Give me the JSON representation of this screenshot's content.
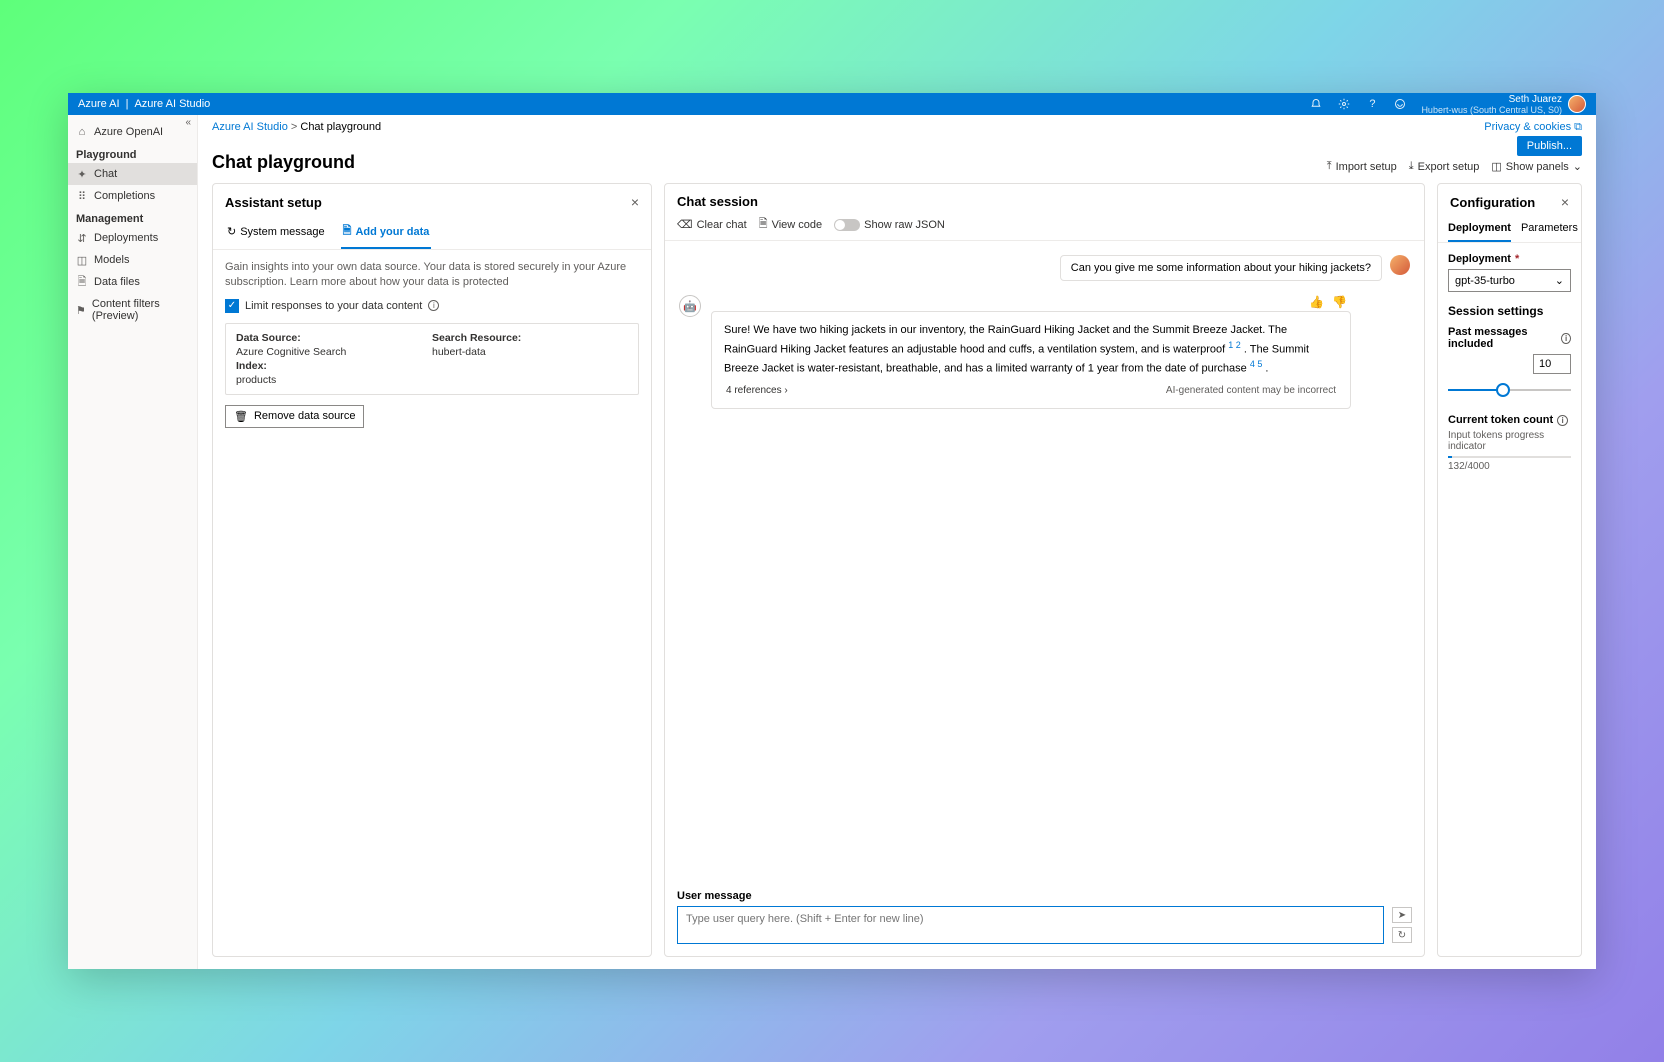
{
  "topbar": {
    "brand_left": "Azure AI",
    "brand_right": "Azure AI Studio",
    "user_name": "Seth Juarez",
    "user_sub": "Hubert-wus (South Central US, S0)"
  },
  "sidebar": {
    "azure_openai": "Azure OpenAI",
    "section_playground": "Playground",
    "chat": "Chat",
    "completions": "Completions",
    "section_management": "Management",
    "deployments": "Deployments",
    "models": "Models",
    "data_files": "Data files",
    "content_filters": "Content filters (Preview)"
  },
  "breadcrumb": {
    "root": "Azure AI Studio",
    "current": "Chat playground",
    "privacy": "Privacy & cookies"
  },
  "page": {
    "title": "Chat playground",
    "publish": "Publish...",
    "import_setup": "Import setup",
    "export_setup": "Export setup",
    "show_panels": "Show panels"
  },
  "assistant": {
    "title": "Assistant setup",
    "tab_system": "System message",
    "tab_data": "Add your data",
    "hint": "Gain insights into your own data source. Your data is stored securely in your Azure subscription. Learn more about how your data is protected",
    "limit_label": "Limit responses to your data content",
    "ds_label": "Data Source:",
    "ds_value": "Azure Cognitive Search",
    "sr_label": "Search Resource:",
    "sr_value": "hubert-data",
    "idx_label": "Index:",
    "idx_value": "products",
    "remove": "Remove data source"
  },
  "chat": {
    "title": "Chat session",
    "clear": "Clear chat",
    "view_code": "View code",
    "raw_json": "Show raw JSON",
    "user_msg": "Can you give me some information about your hiking jackets?",
    "bot_msg_1": "Sure! We have two hiking jackets in our inventory, the RainGuard Hiking Jacket and the Summit Breeze Jacket. The RainGuard Hiking Jacket features an adjustable hood and cuffs, a ventilation system, and is waterproof ",
    "bot_msg_2": " . The Summit Breeze Jacket is water-resistant, breathable, and has a limited warranty of 1 year from the date of purchase ",
    "bot_msg_3": " .",
    "ref1": "1 2",
    "ref2": "4 5",
    "refs_text": "4 references",
    "disclaimer": "AI-generated content may be incorrect",
    "input_label": "User message",
    "input_placeholder": "Type user query here. (Shift + Enter for new line)"
  },
  "config": {
    "title": "Configuration",
    "tab_deploy": "Deployment",
    "tab_params": "Parameters",
    "deploy_label": "Deployment",
    "deploy_value": "gpt-35-turbo",
    "sess_title": "Session settings",
    "past_label": "Past messages included",
    "past_value": "10",
    "token_label": "Current token count",
    "token_sub": "Input tokens progress indicator",
    "token_val": "132/4000"
  }
}
